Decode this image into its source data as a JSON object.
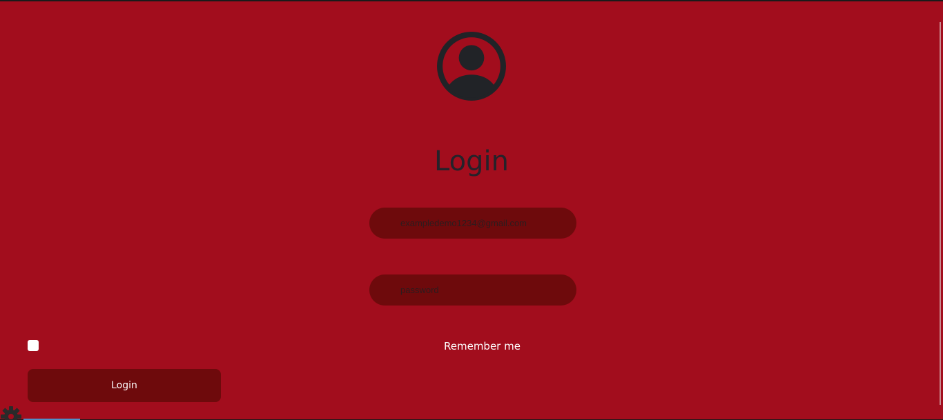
{
  "avatar": {
    "icon": "user-avatar-icon",
    "color": "#212327"
  },
  "login_form": {
    "title": "Login",
    "email_value": "exampledemo1234@gmail.com",
    "password_placeholder": "password",
    "remember_label": "Remember me",
    "remember_checked": false,
    "submit_label": "Login"
  },
  "colors": {
    "background": "#a20d1d",
    "field_bg": "#6e0a0c",
    "button_bg": "#6e0a0c",
    "title_text": "#25222a"
  }
}
